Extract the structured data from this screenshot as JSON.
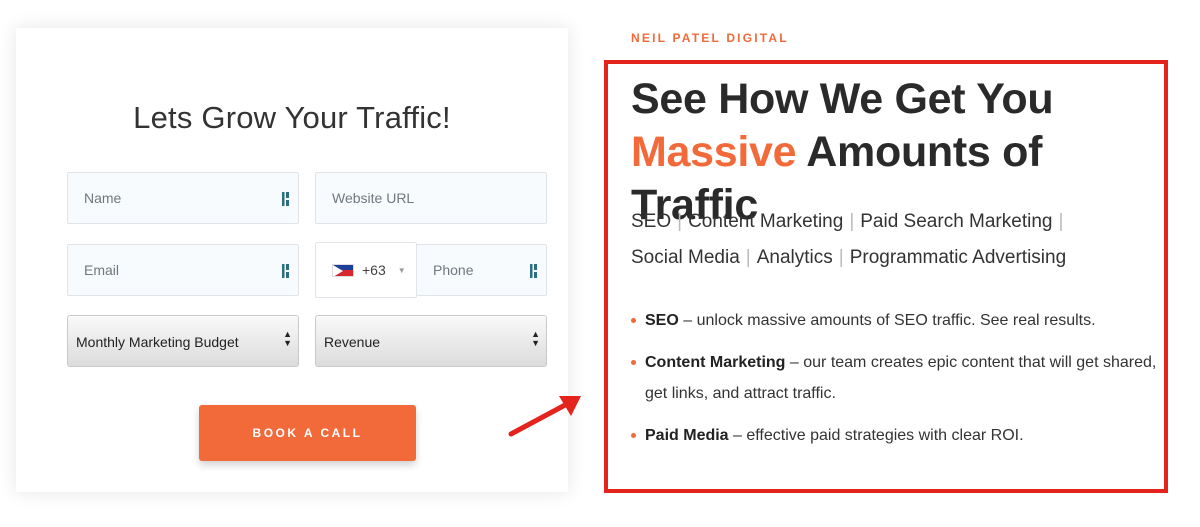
{
  "colors": {
    "accent": "#f2693a",
    "highlight_box": "#e3231c",
    "text": "#2a2a2a"
  },
  "form": {
    "title": "Lets Grow Your Traffic!",
    "name_placeholder": "Name",
    "website_placeholder": "Website URL",
    "email_placeholder": "Email",
    "country_code": "+63",
    "country_flag_icon": "philippines-flag-icon",
    "phone_placeholder": "Phone",
    "budget_select": "Monthly Marketing Budget",
    "revenue_select": "Revenue",
    "submit_label": "BOOK A CALL"
  },
  "panel": {
    "brand": "NEIL PATEL DIGITAL",
    "headline_line1": "See How We Get You",
    "headline_accent": "Massive",
    "headline_rest": " Amounts of Traffic",
    "services": [
      "SEO",
      "Content Marketing",
      "Paid Search Marketing",
      "Social Media",
      "Analytics",
      "Programmatic Advertising"
    ],
    "bullets": [
      {
        "title": "SEO",
        "text": " – unlock massive amounts of SEO traffic. See real results."
      },
      {
        "title": "Content Marketing",
        "text": " – our team creates epic content that will get shared, get links, and attract traffic."
      },
      {
        "title": "Paid Media",
        "text": " – effective paid strategies with clear ROI."
      }
    ]
  }
}
